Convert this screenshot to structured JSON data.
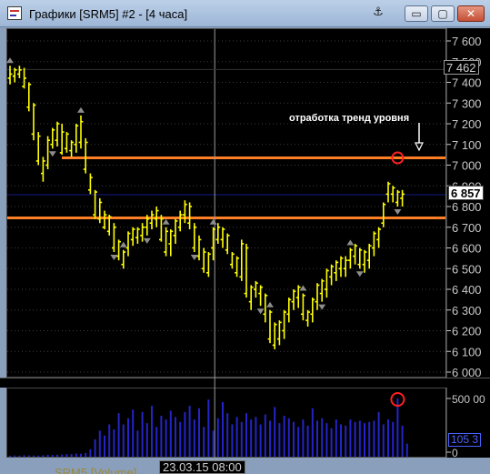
{
  "window": {
    "title": "Графики [SRM5] #2 - [4 часа]",
    "buttons": {
      "minimize": "▭",
      "maximize": "▢",
      "close": "✕",
      "anchor": "⚓"
    }
  },
  "chart_data": [
    {
      "type": "bar",
      "subtype": "ohlc",
      "symbol": "SRM5",
      "timeframe": "4 часа",
      "ylim": [
        6000,
        7650
      ],
      "ticks": [
        "7 600",
        "7 500",
        "7 400",
        "7 300",
        "7 200",
        "7 100",
        "7 000",
        "6 900",
        "6 800",
        "6 700",
        "6 600",
        "6 500",
        "6 400",
        "6 300",
        "6 200",
        "6 100",
        "6 000"
      ],
      "tick_values": [
        7600,
        7500,
        7400,
        7300,
        7200,
        7100,
        7000,
        6900,
        6800,
        6700,
        6600,
        6500,
        6400,
        6300,
        6200,
        6100,
        6000
      ],
      "last_price_label": "6 857",
      "last_price": 6857,
      "crosshair_price_label": "7 462",
      "crosshair_price": 7462,
      "crosshair_time": "23.03.15 08:00",
      "crosshair_bar_index": 46,
      "horizontal_levels": [
        {
          "name": "resistance-level",
          "price": 7035,
          "color": "#ff7f27"
        },
        {
          "name": "support-level",
          "price": 6745,
          "color": "#ff7f27"
        },
        {
          "name": "last-price-line",
          "price": 6857,
          "color": "#1a1a8c"
        }
      ],
      "annotation": "отработка тренд уровня",
      "bar_color": "#ffff00",
      "fractal_color": "#8c8c8c",
      "bars": [
        [
          7480,
          7390,
          7420,
          7440
        ],
        [
          7470,
          7400,
          7430,
          7460
        ],
        [
          7480,
          7420,
          7440,
          7460
        ],
        [
          7470,
          7370,
          7380,
          7420
        ],
        [
          7400,
          7260,
          7280,
          7390
        ],
        [
          7300,
          7120,
          7150,
          7290
        ],
        [
          7160,
          7000,
          7020,
          7140
        ],
        [
          7040,
          6920,
          6960,
          7020
        ],
        [
          7140,
          6980,
          7000,
          7120
        ],
        [
          7180,
          7080,
          7100,
          7170
        ],
        [
          7210,
          7090,
          7120,
          7200
        ],
        [
          7200,
          7050,
          7060,
          7160
        ],
        [
          7160,
          7060,
          7080,
          7150
        ],
        [
          7120,
          7040,
          7070,
          7110
        ],
        [
          7200,
          7060,
          7100,
          7190
        ],
        [
          7240,
          7080,
          7110,
          7210
        ],
        [
          7130,
          6960,
          6980,
          7110
        ],
        [
          6960,
          6860,
          6880,
          6940
        ],
        [
          6880,
          6740,
          6760,
          6870
        ],
        [
          6840,
          6720,
          6740,
          6820
        ],
        [
          6780,
          6690,
          6700,
          6760
        ],
        [
          6760,
          6660,
          6680,
          6750
        ],
        [
          6720,
          6580,
          6600,
          6700
        ],
        [
          6640,
          6540,
          6560,
          6630
        ],
        [
          6590,
          6500,
          6520,
          6580
        ],
        [
          6680,
          6560,
          6600,
          6670
        ],
        [
          6700,
          6610,
          6640,
          6690
        ],
        [
          6700,
          6620,
          6650,
          6690
        ],
        [
          6720,
          6630,
          6660,
          6700
        ],
        [
          6760,
          6660,
          6700,
          6740
        ],
        [
          6780,
          6690,
          6720,
          6760
        ],
        [
          6800,
          6700,
          6740,
          6780
        ],
        [
          6760,
          6630,
          6640,
          6740
        ],
        [
          6700,
          6560,
          6580,
          6680
        ],
        [
          6690,
          6560,
          6620,
          6680
        ],
        [
          6740,
          6620,
          6660,
          6730
        ],
        [
          6780,
          6680,
          6700,
          6760
        ],
        [
          6830,
          6720,
          6760,
          6810
        ],
        [
          6820,
          6690,
          6720,
          6800
        ],
        [
          6720,
          6580,
          6600,
          6700
        ],
        [
          6660,
          6540,
          6560,
          6640
        ],
        [
          6600,
          6480,
          6500,
          6580
        ],
        [
          6580,
          6460,
          6480,
          6570
        ],
        [
          6700,
          6540,
          6600,
          6690
        ],
        [
          6720,
          6620,
          6640,
          6700
        ],
        [
          6700,
          6600,
          6640,
          6690
        ],
        [
          6670,
          6570,
          6590,
          6660
        ],
        [
          6580,
          6500,
          6520,
          6570
        ],
        [
          6560,
          6460,
          6480,
          6550
        ],
        [
          6640,
          6440,
          6460,
          6620
        ],
        [
          6620,
          6360,
          6380,
          6600
        ],
        [
          6420,
          6300,
          6340,
          6410
        ],
        [
          6440,
          6360,
          6400,
          6430
        ],
        [
          6420,
          6320,
          6380,
          6410
        ],
        [
          6380,
          6240,
          6280,
          6370
        ],
        [
          6300,
          6140,
          6160,
          6290
        ],
        [
          6240,
          6110,
          6130,
          6230
        ],
        [
          6250,
          6130,
          6160,
          6240
        ],
        [
          6300,
          6160,
          6200,
          6290
        ],
        [
          6360,
          6240,
          6280,
          6350
        ],
        [
          6400,
          6300,
          6340,
          6390
        ],
        [
          6420,
          6310,
          6360,
          6410
        ],
        [
          6380,
          6250,
          6280,
          6370
        ],
        [
          6300,
          6220,
          6250,
          6290
        ],
        [
          6360,
          6240,
          6280,
          6350
        ],
        [
          6430,
          6300,
          6340,
          6420
        ],
        [
          6450,
          6340,
          6380,
          6440
        ],
        [
          6500,
          6360,
          6400,
          6490
        ],
        [
          6520,
          6420,
          6460,
          6510
        ],
        [
          6540,
          6440,
          6480,
          6530
        ],
        [
          6560,
          6460,
          6500,
          6550
        ],
        [
          6560,
          6460,
          6500,
          6540
        ],
        [
          6600,
          6500,
          6540,
          6590
        ],
        [
          6620,
          6520,
          6560,
          6610
        ],
        [
          6600,
          6500,
          6520,
          6590
        ],
        [
          6590,
          6480,
          6520,
          6580
        ],
        [
          6620,
          6500,
          6540,
          6610
        ],
        [
          6680,
          6560,
          6600,
          6670
        ],
        [
          6700,
          6600,
          6640,
          6690
        ],
        [
          6820,
          6700,
          6720,
          6810
        ],
        [
          6920,
          6820,
          6860,
          6910
        ],
        [
          6900,
          6820,
          6860,
          6890
        ],
        [
          6880,
          6800,
          6820,
          6870
        ],
        [
          6880,
          6800,
          6840,
          6860
        ]
      ],
      "fractals_up": [
        0,
        15,
        24,
        33,
        43,
        55,
        62,
        72
      ],
      "fractals_down": [
        9,
        22,
        29,
        39,
        53,
        66,
        74,
        82
      ],
      "circle_bar_index": 82
    },
    {
      "type": "bar",
      "name": "SRM5 [Volume]",
      "ylim": [
        0,
        520000
      ],
      "ticks": [
        "500 00",
        "0"
      ],
      "tick_values": [
        500000,
        0
      ],
      "last_value_label": "105 3",
      "bar_color": "#2424c8",
      "circle_bar_index": 82,
      "values": [
        8000,
        10000,
        9000,
        12000,
        11000,
        10000,
        9000,
        12000,
        15000,
        14000,
        16000,
        18000,
        20000,
        22000,
        25000,
        24000,
        30000,
        60000,
        140000,
        210000,
        170000,
        260000,
        220000,
        350000,
        260000,
        310000,
        380000,
        210000,
        360000,
        270000,
        410000,
        240000,
        330000,
        300000,
        370000,
        320000,
        280000,
        360000,
        410000,
        300000,
        390000,
        240000,
        460000,
        210000,
        310000,
        440000,
        350000,
        260000,
        320000,
        280000,
        350000,
        300000,
        320000,
        260000,
        340000,
        290000,
        400000,
        270000,
        330000,
        310000,
        280000,
        240000,
        300000,
        250000,
        390000,
        290000,
        310000,
        270000,
        230000,
        300000,
        260000,
        250000,
        300000,
        280000,
        290000,
        270000,
        280000,
        290000,
        360000,
        260000,
        300000,
        280000,
        470000,
        250000,
        105300
      ]
    }
  ],
  "labels": {
    "annotation": "отработка тренд уровня",
    "crosshair_time": "23.03.15 08:00",
    "last_price": "6 857",
    "crosshair_price": "7 462",
    "volume_last": "105 3",
    "volume_indicator": "SRM5 [Volume]"
  },
  "colors": {
    "background": "#000000",
    "bars": "#ffff00",
    "levels": "#ff7f27",
    "last_price_line": "#1a1a8c",
    "volume": "#2424c8",
    "circle": "#ff2020",
    "grid": "#3a3a3a"
  }
}
